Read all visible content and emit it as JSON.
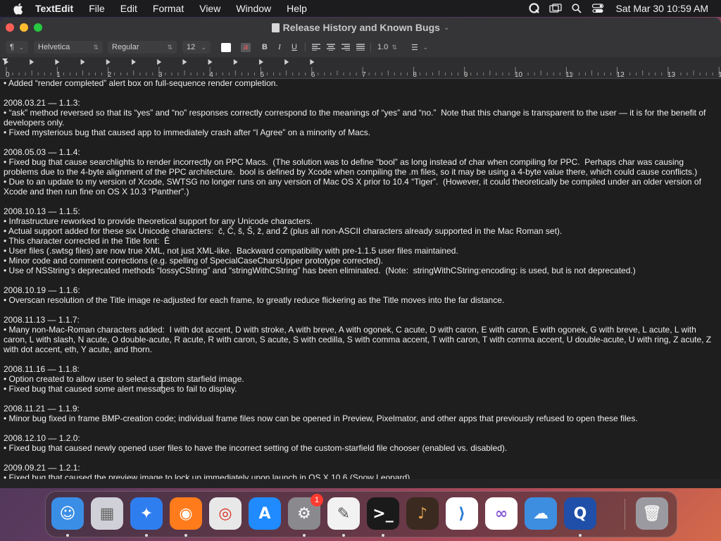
{
  "menubar": {
    "app_name": "TextEdit",
    "items": [
      "File",
      "Edit",
      "Format",
      "View",
      "Window",
      "Help"
    ],
    "status_icons": [
      "quicktime-icon",
      "screen-mirroring-icon",
      "spotlight-search-icon",
      "control-center-icon"
    ],
    "clock": "Sat Mar 30  10:59 AM"
  },
  "window": {
    "title": "Release History and Known Bugs",
    "traffic_colors": {
      "close": "#ff5f57",
      "minimize": "#febc2e",
      "zoom": "#28c840"
    }
  },
  "toolbar": {
    "paragraph_style": "¶",
    "font_family": "Helvetica",
    "font_style": "Regular",
    "font_size": "12",
    "bold": "B",
    "italic": "I",
    "underline": "U",
    "line_spacing": "1.0",
    "list_style": "☰"
  },
  "ruler": {
    "labels": [
      "0",
      "1",
      "2",
      "3",
      "4",
      "5",
      "6",
      "7",
      "8",
      "9",
      "10",
      "11",
      "12",
      "13",
      "14"
    ]
  },
  "document": {
    "lines": [
      "• Added “render completed” alert box on full-sequence render completion.",
      "",
      "2008.03.21 — 1.1.3:",
      "• “ask” method reversed so that its “yes” and “no” responses correctly correspond to the meanings of “yes” and “no.”  Note that this change is transparent to the user — it is for the benefit of",
      "developers only.",
      "• Fixed mysterious bug that caused app to immediately crash after “I Agree” on a minority of Macs.",
      "",
      "2008.05.03 — 1.1.4:",
      "• Fixed bug that cause searchlights to render incorrectly on PPC Macs.  (The solution was to define “bool” as long instead of char when compiling for PPC.  Perhaps char was causing",
      "problems due to the 4-byte alignment of the PPC architecture.  bool is defined by Xcode when compiling the .m files, so it may be using a 4-byte value there, which could cause conflicts.)",
      "• Due to an update to my version of Xcode, SWTSG no longer runs on any version of Mac OS X prior to 10.4 “Tiger”.  (However, it could theoretically be compiled under an older version of",
      "Xcode and then run fine on OS X 10.3 “Panther”.)",
      "",
      "2008.10.13 — 1.1.5:",
      "• Infrastructure reworked to provide theoretical support for any Unicode characters.",
      "• Actual support added for these six Unicode characters:  č, Č, š, Š, ž, and Ž (plus all non-ASCII characters already supported in the Mac Roman set).",
      "• This character corrected in the Title font:  Ê",
      "• User files (.swtsg files) are now true XML, not just XML-like.  Backward compatibility with pre-1.1.5 user files maintained.",
      "• Minor code and comment corrections (e.g. spelling of SpecialCaseCharsUpper prototype corrected).",
      "• Use of NSString’s deprecated methods “lossyCString” and “stringWithCString” has been eliminated.  (Note:  stringWithCString:encoding: is used, but is not deprecated.)",
      "",
      "2008.10.19 — 1.1.6:",
      "• Overscan resolution of the Title image re-adjusted for each frame, to greatly reduce flickering as the Title moves into the far distance.",
      "",
      "2008.11.13 — 1.1.7:",
      "• Many non-Mac-Roman characters added:  I with dot accent, D with stroke, A with breve, A with ogonek, C acute, D with caron, E with caron, E with ogonek, G with breve, L acute, L with",
      "caron, L with slash, N acute, O double-acute, R acute, R with caron, S acute, S with cedilla, S with comma accent, T with caron, T with comma accent, U double-acute, U with ring, Z acute, Z",
      "with dot accent, eth, Y acute, and thorn.",
      "",
      "2008.11.16 — 1.1.8:",
      "• Option created to allow user to select a custom starfield image.",
      "• Fixed bug that caused some alert messages to fail to display.",
      "",
      "2008.11.21 — 1.1.9:",
      "• Minor bug fixed in frame BMP-creation code; individual frame files now can be opened in Preview, Pixelmator, and other apps that previously refused to open these files.",
      "",
      "2008.12.10 — 1.2.0:",
      "• Fixed bug that caused newly opened user files to have the incorrect setting of the custom-starfield file chooser (enabled vs. disabled).",
      "",
      "2009.09.21 — 1.2.1:",
      "• Fixed bug that caused the preview image to lock up immediately upon launch in OS X 10.6 (Snow Leopard)."
    ]
  },
  "dock": {
    "items": [
      {
        "name": "finder-icon",
        "color": "#3a8ee6",
        "running": true
      },
      {
        "name": "launchpad-icon",
        "color": "#d0d0d8",
        "running": false
      },
      {
        "name": "safari-icon",
        "color": "#2f7ef0",
        "running": true
      },
      {
        "name": "firefox-icon",
        "color": "#ff7b1c",
        "running": true
      },
      {
        "name": "chrome-icon",
        "color": "#e8e8e8",
        "running": false
      },
      {
        "name": "app-store-icon",
        "color": "#1f8bff",
        "running": false
      },
      {
        "name": "system-settings-icon",
        "color": "#8a8a8e",
        "running": true,
        "badge": "1"
      },
      {
        "name": "textedit-icon",
        "color": "#f2f2f2",
        "running": true
      },
      {
        "name": "terminal-icon",
        "color": "#1a1a1a",
        "running": true
      },
      {
        "name": "garageband-icon",
        "color": "#3a2a20",
        "running": false
      },
      {
        "name": "vscode-icon",
        "color": "#ffffff",
        "running": false
      },
      {
        "name": "visual-studio-icon",
        "color": "#ffffff",
        "running": false
      },
      {
        "name": "weather-icon",
        "color": "#3d8de0",
        "running": false
      },
      {
        "name": "quicktime-player-icon",
        "color": "#1f4fa8",
        "running": true
      },
      {
        "name": "trash-icon",
        "color": "#9a9aa0",
        "running": false
      }
    ]
  }
}
